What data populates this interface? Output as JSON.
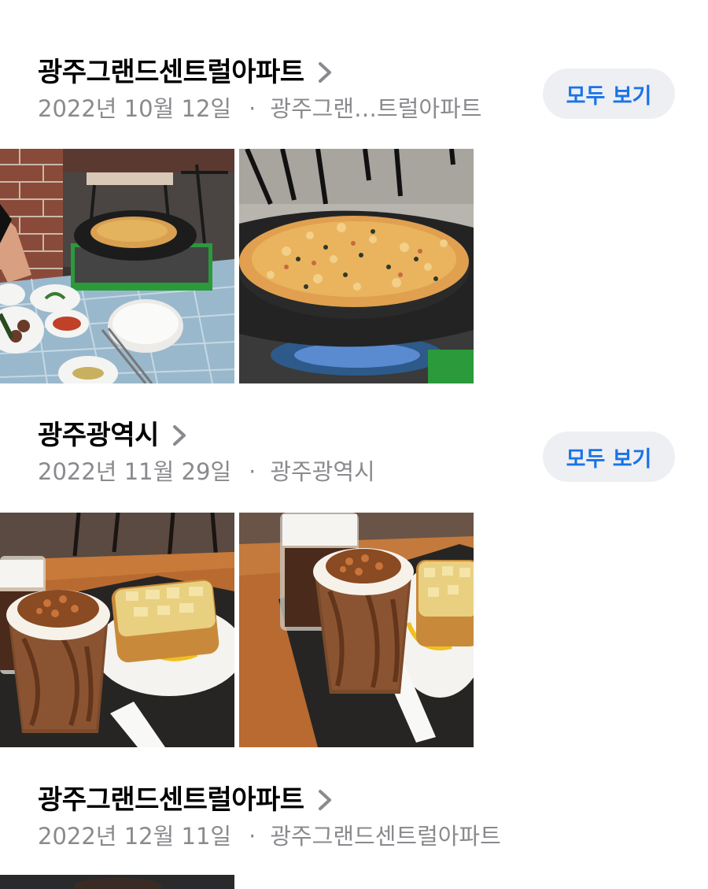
{
  "sections": [
    {
      "title": "광주그랜드센트럴아파트",
      "date": "2022년 10월 12일",
      "separator": "·",
      "location": "광주그랜…트럴아파트",
      "see_all": "모두 보기",
      "photos": [
        "pancake-table-photo",
        "pancake-pan-photo"
      ]
    },
    {
      "title": "광주광역시",
      "date": "2022년 11월 29일",
      "separator": "·",
      "location": "광주광역시",
      "see_all": "모두 보기",
      "photos": [
        "cafe-drink-toast-photo",
        "cafe-drink-toast-closeup-photo"
      ]
    },
    {
      "title": "광주그랜드센트럴아파트",
      "date": "2022년 12월 11일",
      "separator": "·",
      "location": "광주그랜드센트럴아파트",
      "photos": [
        "portrait-photo"
      ]
    }
  ],
  "icons": {
    "chevron": "chevron-right-icon"
  },
  "colors": {
    "accent": "#1a73e8",
    "secondary_text": "#8a8a8e",
    "button_bg": "#eeeff3"
  }
}
